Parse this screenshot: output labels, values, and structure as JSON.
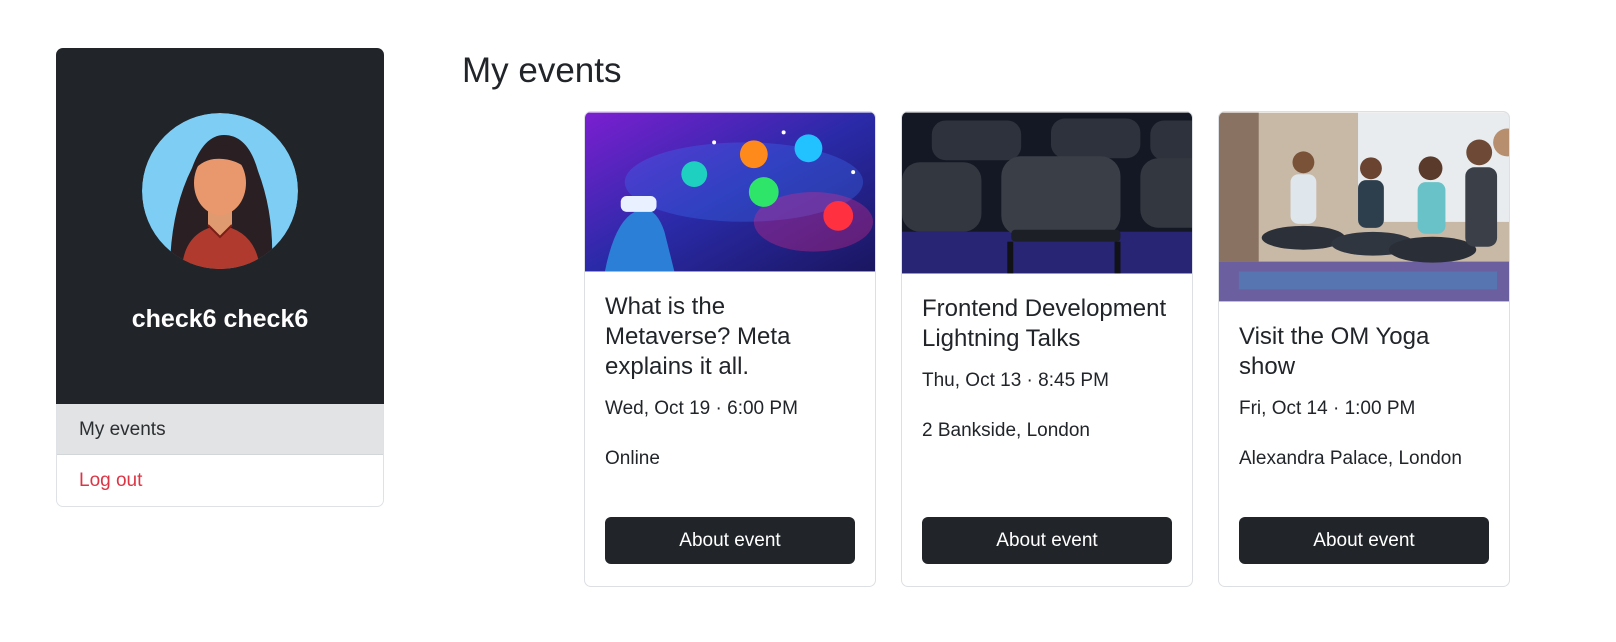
{
  "sidebar": {
    "user_name": "check6 check6",
    "menu": [
      {
        "label": "My events",
        "active": true
      },
      {
        "label": "Log out",
        "active": false
      }
    ]
  },
  "main": {
    "title": "My events",
    "events": [
      {
        "title": "What is the Metaverse? Meta explains it all.",
        "date": "Wed, Oct 19 · 6:00 PM",
        "location": "Online",
        "button": "About event"
      },
      {
        "title": "Frontend Development Lightning Talks",
        "date": "Thu, Oct 13 · 8:45 PM",
        "location": "2 Bankside, London",
        "button": "About event"
      },
      {
        "title": "Visit the OM Yoga show",
        "date": "Fri, Oct 14 · 1:00 PM",
        "location": "Alexandra Palace, London",
        "button": "About event"
      }
    ]
  },
  "colors": {
    "dark": "#212529",
    "danger": "#dc3545",
    "active_bg": "#e2e3e5"
  }
}
